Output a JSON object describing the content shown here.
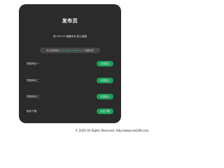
{
  "card": {
    "title": "发布页",
    "hint": "按 Ctrl+D 收藏本页 防止迷路",
    "url_prefix": "永久发布网址",
    "url": "http://www.net168.com",
    "url_suffix": "收藏本页"
  },
  "links": [
    {
      "label": "导航网址一",
      "button": "点击进入"
    },
    {
      "label": "导航网址二",
      "button": "点击进入"
    },
    {
      "label": "导航网址三",
      "button": "点击进入"
    },
    {
      "label": "软件下载",
      "button": "点击下载"
    }
  ],
  "footer": {
    "text": "© 2025 All Rights Reserved, http://www.net168.com"
  },
  "colors": {
    "card_bg": "#2b2b2b",
    "button_bg": "#1aa057",
    "link_accent": "#3cc47a"
  }
}
